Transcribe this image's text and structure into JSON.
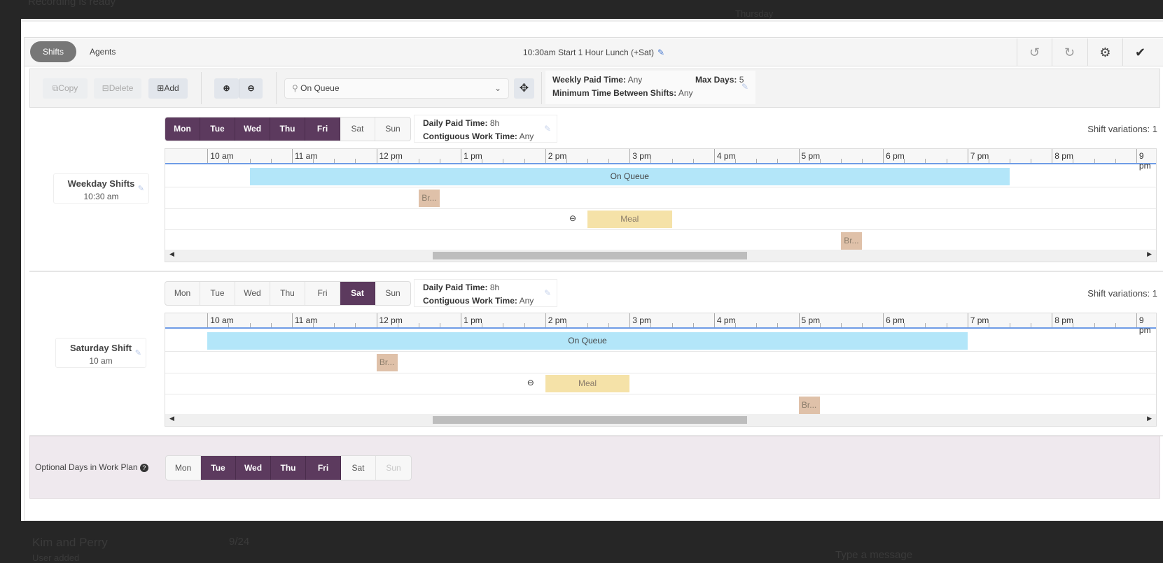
{
  "background": {
    "top_text": "Recording is ready",
    "center_text": "Thursday",
    "chat_name": "Kim and Perry",
    "chat_date": "9/24",
    "chat_sub": "User added",
    "message_placeholder": "Type a message"
  },
  "tabs": [
    {
      "label": "Shifts",
      "active": true
    },
    {
      "label": "Agents",
      "active": false
    }
  ],
  "plan_title": "10:30am Start 1 Hour Lunch (+Sat)",
  "top_actions": [
    {
      "icon": "undo-icon",
      "glyph": "↺"
    },
    {
      "icon": "redo-icon",
      "glyph": "↻"
    },
    {
      "icon": "gear-icon",
      "glyph": "⚙"
    },
    {
      "icon": "check-icon",
      "glyph": "✔"
    }
  ],
  "toolbar": {
    "copy": "Copy",
    "delete": "Delete",
    "add": "Add",
    "activity_select": "On Queue",
    "weekly_paid_label": "Weekly Paid Time:",
    "weekly_paid_value": "Any",
    "max_days_label": "Max Days:",
    "max_days_value": "5",
    "min_between_label": "Minimum Time Between Shifts:",
    "min_between_value": "Any"
  },
  "hour_labels": [
    "10 am",
    "11 am",
    "12 pm",
    "1 pm",
    "2 pm",
    "3 pm",
    "4 pm",
    "5 pm",
    "6 pm",
    "7 pm",
    "8 pm",
    "9 pm"
  ],
  "colors": {
    "selected_day": "#5c3a5e",
    "on_queue": "#b3e6f9",
    "break": "#dfc1a9",
    "meal": "#f5e2a8"
  },
  "shifts": [
    {
      "name": "Weekday Shifts",
      "start": "10:30 am",
      "days": [
        {
          "d": "Mon",
          "on": true
        },
        {
          "d": "Tue",
          "on": true
        },
        {
          "d": "Wed",
          "on": true
        },
        {
          "d": "Thu",
          "on": true
        },
        {
          "d": "Fri",
          "on": true
        },
        {
          "d": "Sat",
          "on": false
        },
        {
          "d": "Sun",
          "on": false
        }
      ],
      "daily_paid_label": "Daily Paid Time:",
      "daily_paid_value": "8h",
      "contig_label": "Contiguous Work Time:",
      "contig_value": "Any",
      "variations": "Shift variations: 1",
      "activities": [
        {
          "label": "On Queue",
          "type": "on_queue",
          "start": "10:30",
          "end": "19:30"
        },
        {
          "label": "Br...",
          "type": "break",
          "start": "12:30",
          "end": "12:45"
        },
        {
          "label": "Meal",
          "type": "meal",
          "start": "14:30",
          "end": "15:30"
        },
        {
          "label": "Br...",
          "type": "break",
          "start": "17:30",
          "end": "17:45"
        }
      ]
    },
    {
      "name": "Saturday Shift",
      "start": "10 am",
      "days": [
        {
          "d": "Mon",
          "on": false
        },
        {
          "d": "Tue",
          "on": false
        },
        {
          "d": "Wed",
          "on": false
        },
        {
          "d": "Thu",
          "on": false
        },
        {
          "d": "Fri",
          "on": false
        },
        {
          "d": "Sat",
          "on": true
        },
        {
          "d": "Sun",
          "on": false
        }
      ],
      "daily_paid_label": "Daily Paid Time:",
      "daily_paid_value": "8h",
      "contig_label": "Contiguous Work Time:",
      "contig_value": "Any",
      "variations": "Shift variations: 1",
      "activities": [
        {
          "label": "On Queue",
          "type": "on_queue",
          "start": "10:00",
          "end": "19:00"
        },
        {
          "label": "Br...",
          "type": "break",
          "start": "12:00",
          "end": "12:15"
        },
        {
          "label": "Meal",
          "type": "meal",
          "start": "14:00",
          "end": "15:00"
        },
        {
          "label": "Br...",
          "type": "break",
          "start": "17:00",
          "end": "17:15"
        }
      ]
    }
  ],
  "optional": {
    "label": "Optional Days in Work Plan",
    "days": [
      {
        "d": "Mon",
        "state": "off"
      },
      {
        "d": "Tue",
        "state": "on"
      },
      {
        "d": "Wed",
        "state": "on"
      },
      {
        "d": "Thu",
        "state": "on"
      },
      {
        "d": "Fri",
        "state": "on"
      },
      {
        "d": "Sat",
        "state": "off"
      },
      {
        "d": "Sun",
        "state": "disabled"
      }
    ]
  }
}
